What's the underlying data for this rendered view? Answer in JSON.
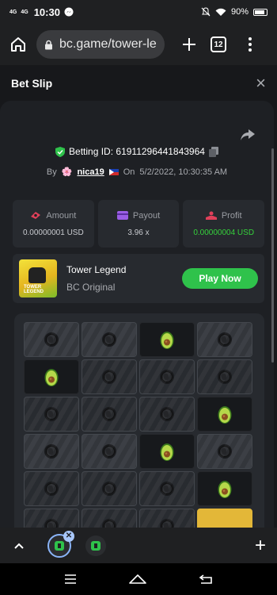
{
  "status_bar": {
    "signal_1": "4G",
    "signal_2": "4G",
    "time": "10:30",
    "battery": "90%",
    "icons": [
      "signal-icon",
      "messenger-icon",
      "mute-icon",
      "wifi-icon",
      "battery-icon"
    ]
  },
  "browser": {
    "url": "bc.game/tower-le",
    "tab_count": "12"
  },
  "bet_slip": {
    "title": "Bet Slip",
    "close": "×",
    "betting_id": "Betting ID: 61911296441843964",
    "by_label": "By",
    "username": "nica19",
    "on_label": "On",
    "date": "5/2/2022, 10:30:35 AM"
  },
  "stats": [
    {
      "label": "Amount",
      "value": "0.00000001 USD",
      "icon": "amount-icon",
      "color": "#e0405a"
    },
    {
      "label": "Payout",
      "value": "3.96 x",
      "icon": "payout-icon",
      "color": "#9b5de5"
    },
    {
      "label": "Profit",
      "value": "0.00000004 USD",
      "icon": "profit-icon",
      "color": "#e0405a"
    }
  ],
  "game": {
    "name": "Tower Legend",
    "subtitle": "BC Original",
    "play_label": "Play Now",
    "thumb_text": "TOWER LEGEND"
  },
  "board": {
    "rows": [
      [
        "tile",
        "tile",
        "avocado",
        "tile"
      ],
      [
        "avocado",
        "tile-dark",
        "tile-dark",
        "tile-dark"
      ],
      [
        "tile-dark",
        "tile-dark",
        "tile-dark",
        "avocado"
      ],
      [
        "tile",
        "tile",
        "avocado",
        "tile"
      ],
      [
        "tile-dark",
        "tile-dark",
        "tile-dark",
        "avocado"
      ],
      [
        "tile-dark",
        "tile-dark",
        "tile-dark",
        "gold"
      ]
    ]
  },
  "colors": {
    "accent_green": "#2fc24b",
    "profit_green": "#35d13b",
    "panel": "#272a2f",
    "background": "#1e2024"
  }
}
